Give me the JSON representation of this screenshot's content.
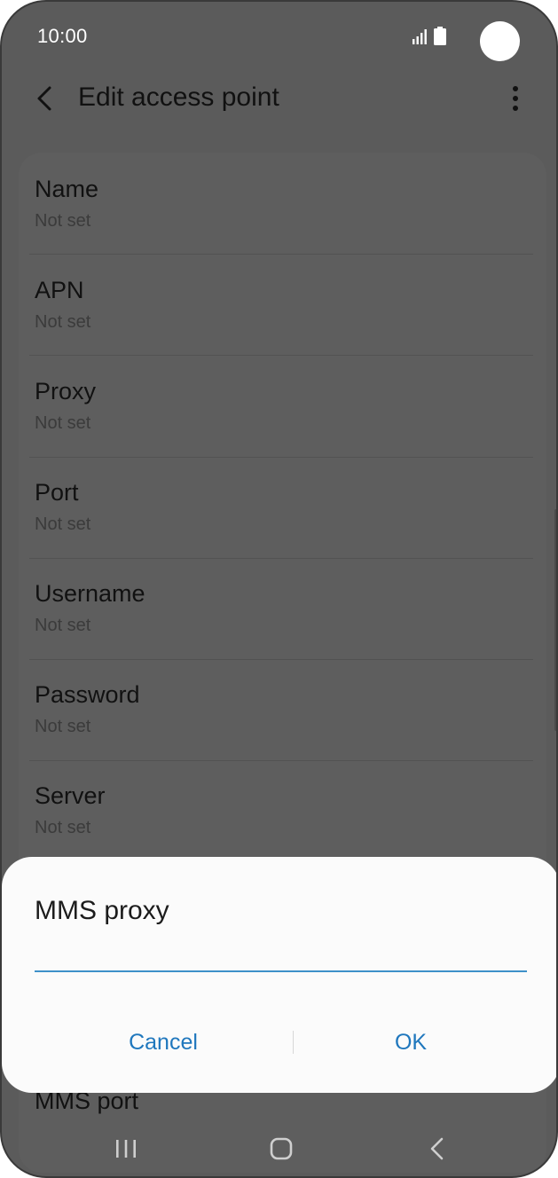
{
  "status_bar": {
    "time": "10:00"
  },
  "header": {
    "title": "Edit access point"
  },
  "settings": {
    "items": [
      {
        "label": "Name",
        "value": "Not set"
      },
      {
        "label": "APN",
        "value": "Not set"
      },
      {
        "label": "Proxy",
        "value": "Not set"
      },
      {
        "label": "Port",
        "value": "Not set"
      },
      {
        "label": "Username",
        "value": "Not set"
      },
      {
        "label": "Password",
        "value": "Not set"
      },
      {
        "label": "Server",
        "value": "Not set"
      }
    ],
    "below_dialog_item": "MMS port"
  },
  "dialog": {
    "title": "MMS proxy",
    "input_value": "",
    "cancel_label": "Cancel",
    "ok_label": "OK"
  },
  "colors": {
    "accent": "#1f77bd",
    "input_underline": "#3e91c9",
    "dim_background": "#5b5b5b"
  },
  "icons": {
    "back": "back-chevron-icon",
    "more": "more-vertical-icon",
    "signal": "signal-icon",
    "battery": "battery-icon",
    "nav_recents": "recents-icon",
    "nav_home": "home-icon",
    "nav_back": "nav-back-icon"
  }
}
